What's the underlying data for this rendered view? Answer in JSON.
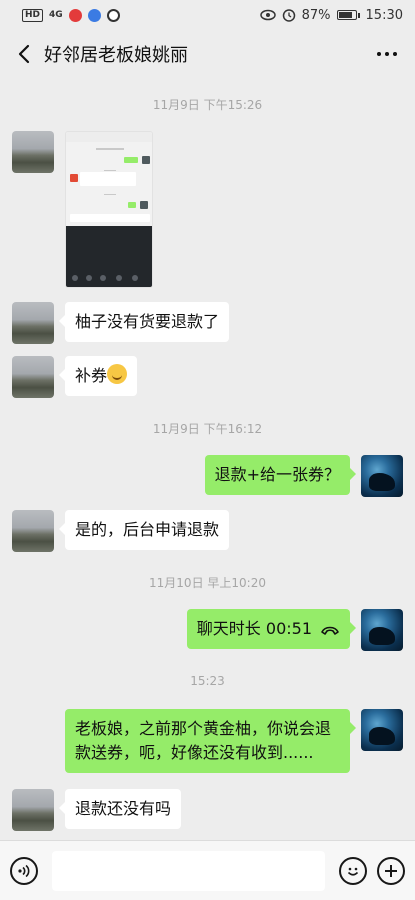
{
  "status_bar": {
    "hd": "HD",
    "network": "4G",
    "battery_text": "87%",
    "battery_level": 0.87,
    "time": "15:30"
  },
  "header": {
    "title": "好邻居老板娘姚丽"
  },
  "timestamps": [
    "11月9日 下午15:26",
    "11月9日 下午16:12",
    "11月10日 早上10:20",
    "15:23"
  ],
  "messages": {
    "m1": "柚子没有货要退款了",
    "m2_text": "补券",
    "m2_emoji": "grin-emoji",
    "m3": "退款+给一张券？",
    "m4": "是的，后台申请退款",
    "m5_call": "聊天时长 00:51",
    "m6": "老板娘，之前那个黄金柚，你说会退款送券，呃，好像还没有收到......",
    "m7": "退款还没有吗"
  },
  "colors": {
    "background": "#ededed",
    "mine_bubble": "#95ec69",
    "other_bubble": "#ffffff",
    "timestamp": "#a6a6a6"
  },
  "icons": [
    "back-icon",
    "more-icon",
    "voice-icon",
    "emoji-icon",
    "plus-icon",
    "phone-icon"
  ]
}
